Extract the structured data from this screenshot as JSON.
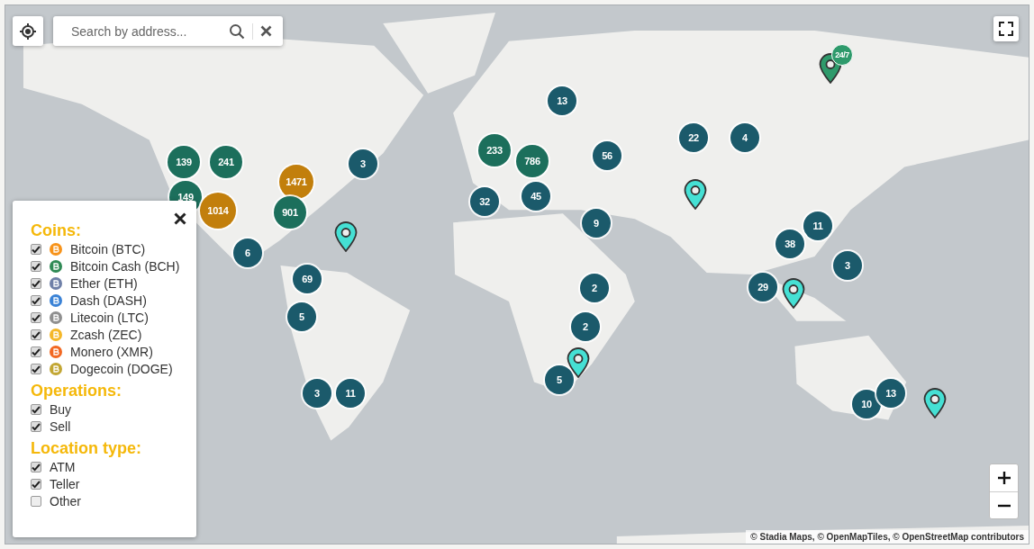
{
  "search": {
    "placeholder": "Search by address..."
  },
  "clusters": [
    {
      "label": "139",
      "color": "#1c6f5c"
    },
    {
      "label": "241",
      "color": "#1c6f5c"
    },
    {
      "label": "149",
      "color": "#1c6f5c"
    },
    {
      "label": "1471",
      "color": "#c27f0c"
    },
    {
      "label": "1014",
      "color": "#c27f0c"
    },
    {
      "label": "901",
      "color": "#1c6f5c"
    },
    {
      "label": "3",
      "color": "#1b5a6b"
    },
    {
      "label": "6",
      "color": "#1b5a6b"
    },
    {
      "label": "69",
      "color": "#1b5a6b"
    },
    {
      "label": "5",
      "color": "#1b5a6b"
    },
    {
      "label": "3",
      "color": "#1b5a6b"
    },
    {
      "label": "11",
      "color": "#1b5a6b"
    },
    {
      "label": "13",
      "color": "#1b5a6b"
    },
    {
      "label": "233",
      "color": "#1c6f5c"
    },
    {
      "label": "786",
      "color": "#1c6f5c"
    },
    {
      "label": "56",
      "color": "#1b5a6b"
    },
    {
      "label": "32",
      "color": "#1b5a6b"
    },
    {
      "label": "45",
      "color": "#1b5a6b"
    },
    {
      "label": "9",
      "color": "#1b5a6b"
    },
    {
      "label": "2",
      "color": "#1b5a6b"
    },
    {
      "label": "2",
      "color": "#1b5a6b"
    },
    {
      "label": "5",
      "color": "#1b5a6b"
    },
    {
      "label": "22",
      "color": "#1b5a6b"
    },
    {
      "label": "4",
      "color": "#1b5a6b"
    },
    {
      "label": "11",
      "color": "#1b5a6b"
    },
    {
      "label": "38",
      "color": "#1b5a6b"
    },
    {
      "label": "3",
      "color": "#1b5a6b"
    },
    {
      "label": "29",
      "color": "#1b5a6b"
    },
    {
      "label": "10",
      "color": "#1b5a6b"
    },
    {
      "label": "13",
      "color": "#1b5a6b"
    }
  ],
  "pins": [
    {
      "color": "#45e0d4"
    },
    {
      "color": "#45e0d4"
    },
    {
      "color": "#45e0d4"
    },
    {
      "color": "#45e0d4"
    },
    {
      "color": "#45e0d4"
    },
    {
      "color": "#2e9a6b",
      "badge": "24/7"
    }
  ],
  "filters": {
    "sections": [
      {
        "title": "Coins:",
        "items": [
          {
            "label": "Bitcoin (BTC)",
            "checked": true,
            "color": "#f7931a"
          },
          {
            "label": "Bitcoin Cash (BCH)",
            "checked": true,
            "color": "#2f8a55"
          },
          {
            "label": "Ether (ETH)",
            "checked": true,
            "color": "#6f80a8"
          },
          {
            "label": "Dash (DASH)",
            "checked": true,
            "color": "#3a82d6"
          },
          {
            "label": "Litecoin (LTC)",
            "checked": true,
            "color": "#8f8f8f"
          },
          {
            "label": "Zcash (ZEC)",
            "checked": true,
            "color": "#f4b728"
          },
          {
            "label": "Monero (XMR)",
            "checked": true,
            "color": "#f26822"
          },
          {
            "label": "Dogecoin (DOGE)",
            "checked": true,
            "color": "#c2a633"
          }
        ]
      },
      {
        "title": "Operations:",
        "items": [
          {
            "label": "Buy",
            "checked": true
          },
          {
            "label": "Sell",
            "checked": true
          }
        ]
      },
      {
        "title": "Location type:",
        "items": [
          {
            "label": "ATM",
            "checked": true
          },
          {
            "label": "Teller",
            "checked": true
          },
          {
            "label": "Other",
            "checked": false
          }
        ]
      }
    ]
  },
  "attribution": "© Stadia Maps, © OpenMapTiles, © OpenStreetMap contributors"
}
